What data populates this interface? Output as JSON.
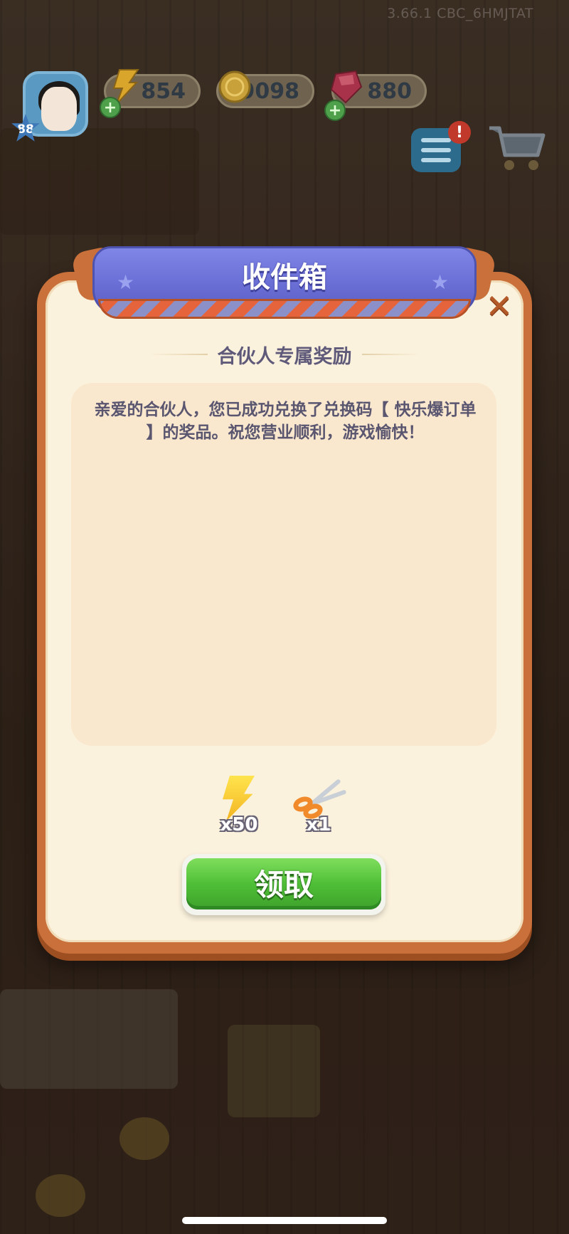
{
  "app": {
    "version_label": "3.66.1 CBC_6HMJTAT"
  },
  "hud": {
    "level": "88",
    "energy": "854",
    "coins": "9098",
    "gems": "880",
    "plus_symbol": "+",
    "alert_symbol": "!",
    "icons": [
      "avatar",
      "lightning-bolt-icon",
      "coin-icon",
      "gem-icon",
      "plus-icon",
      "task-list-icon",
      "shopping-cart-icon"
    ]
  },
  "modal": {
    "title": "收件箱",
    "subtitle": "合伙人专属奖励",
    "message": "亲爱的合伙人，您已成功兑换了兑换码【 快乐爆订单 】的奖品。祝您营业顺利，游戏愉快！",
    "close_symbol": "✕",
    "rewards": [
      {
        "name": "energy",
        "icon": "lightning-bolt-icon",
        "quantity": "x50"
      },
      {
        "name": "scissors",
        "icon": "scissors-icon",
        "quantity": "x1"
      }
    ],
    "claim_button": "领取"
  },
  "colors": {
    "frame": "#c9703b",
    "panel": "#fbf2dd",
    "banner": "#6a6fd6",
    "claim": "#4fbf37"
  }
}
